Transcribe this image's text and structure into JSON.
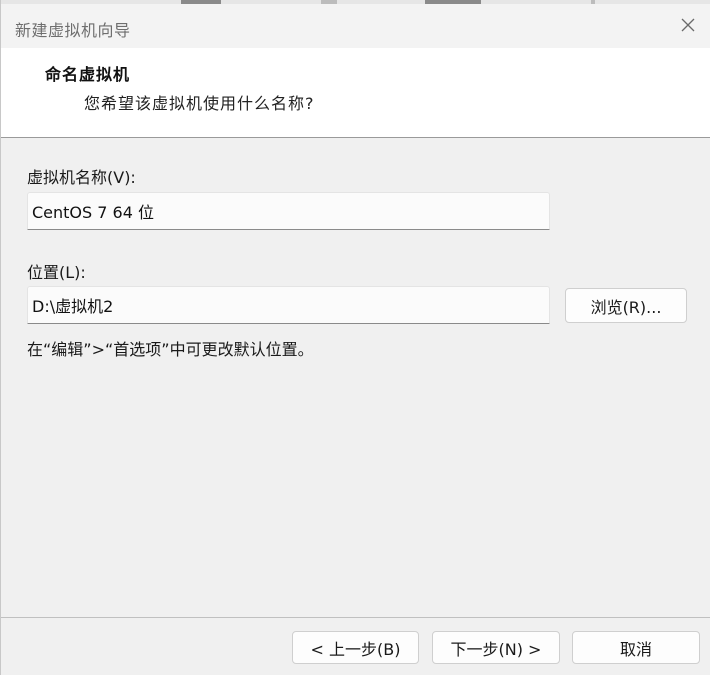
{
  "window": {
    "title": "新建虚拟机向导",
    "close_symbol": "✕"
  },
  "header": {
    "title": "命名虚拟机",
    "subtitle": "您希望该虚拟机使用什么名称?"
  },
  "form": {
    "name_label": "虚拟机名称(V):",
    "name_value": "CentOS 7 64 位",
    "location_label": "位置(L):",
    "location_value": "D:\\虚拟机2",
    "browse_label": "浏览(R)...",
    "hint": "在“编辑”>“首选项”中可更改默认位置。"
  },
  "footer": {
    "back_label": "< 上一步(B)",
    "next_label": "下一步(N) >",
    "cancel_label": "取消"
  },
  "colors": {
    "header_bg": "#ffffff",
    "body_bg": "#f0f0f0",
    "title_text": "#6e6e6e"
  }
}
